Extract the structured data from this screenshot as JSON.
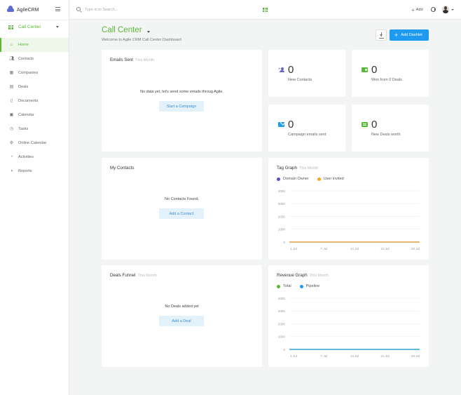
{
  "app": {
    "name": "AgileCRM"
  },
  "module": {
    "label": "Call Center"
  },
  "nav": [
    {
      "label": "Home",
      "icon": "home-icon",
      "active": true
    },
    {
      "label": "Contacts",
      "icon": "contacts-icon"
    },
    {
      "label": "Companies",
      "icon": "companies-icon"
    },
    {
      "label": "Deals",
      "icon": "deals-icon"
    },
    {
      "label": "Documents",
      "icon": "documents-icon"
    },
    {
      "label": "Calendar",
      "icon": "calendar-icon"
    },
    {
      "label": "Tasks",
      "icon": "tasks-icon"
    },
    {
      "label": "Online Calendar",
      "icon": "online-calendar-icon"
    },
    {
      "label": "Activities",
      "icon": "activities-icon"
    },
    {
      "label": "Reports",
      "icon": "reports-icon"
    }
  ],
  "topbar": {
    "search_placeholder": "Type in to Search...",
    "add_label": "Add"
  },
  "header": {
    "title": "Call Center",
    "subtitle": "Welcome to Agile CRM Call Center Dashboard",
    "add_dashlet": "Add Dashlet"
  },
  "emails_sent": {
    "title": "Emails Sent",
    "period": "This Month",
    "message": "No data yet, let's send some emails throug Agile.",
    "button": "Start a Campaign"
  },
  "stats": [
    {
      "value": "0",
      "label": "New Contacts",
      "icon": "new-contacts-icon"
    },
    {
      "value": "0",
      "label": "Won from 0 Deals",
      "icon": "won-deals-icon"
    },
    {
      "value": "0",
      "label": "Campaign emails sent",
      "icon": "campaign-email-icon"
    },
    {
      "value": "0",
      "label": "New Deals worth",
      "icon": "new-deals-icon"
    }
  ],
  "my_contacts": {
    "title": "My Contacts",
    "message": "No Contacts Found.",
    "button": "Add a Contact"
  },
  "deals_funnel": {
    "title": "Deals Funnel",
    "period": "This Month",
    "message": "No Deals added yet",
    "button": "Add a Deal"
  },
  "tag_graph": {
    "title": "Tag Graph",
    "period": "This Month"
  },
  "revenue_graph": {
    "title": "Revenue Graph",
    "period": "This Month"
  },
  "colors": {
    "brand_green": "#5ab837",
    "primary_blue": "#1e9bf0",
    "domain_owner": "#5c4fc4",
    "user_invited": "#f5a623",
    "total": "#5ab837",
    "pipeline": "#1e9bf0"
  },
  "chart_data": [
    {
      "type": "line",
      "title": "Tag Graph",
      "categories": [
        "1 Jul",
        "7 Jul",
        "14 Jul",
        "21 Jul",
        "28 Jul"
      ],
      "ylim": [
        0,
        4000
      ],
      "yticks": [
        0,
        1000,
        2000,
        3000,
        4000
      ],
      "grid": true,
      "legend": "top-left",
      "series": [
        {
          "name": "Domain Owner",
          "color": "#5c4fc4",
          "values": [
            0,
            0,
            0,
            0,
            0
          ]
        },
        {
          "name": "User invited",
          "color": "#f5a623",
          "values": [
            0,
            0,
            0,
            0,
            0
          ]
        }
      ]
    },
    {
      "type": "line",
      "title": "Revenue Graph",
      "categories": [
        "1 Jul",
        "7 Jul",
        "14 Jul",
        "21 Jul",
        "28 Jul"
      ],
      "ylim": [
        0,
        4000
      ],
      "yticks": [
        0,
        1000,
        2000,
        3000,
        4000
      ],
      "grid": true,
      "legend": "top-left",
      "series": [
        {
          "name": "Total",
          "color": "#5ab837",
          "values": [
            0,
            0,
            0,
            0,
            0
          ]
        },
        {
          "name": "Pipeline",
          "color": "#1e9bf0",
          "values": [
            0,
            0,
            0,
            0,
            0
          ]
        }
      ]
    }
  ]
}
